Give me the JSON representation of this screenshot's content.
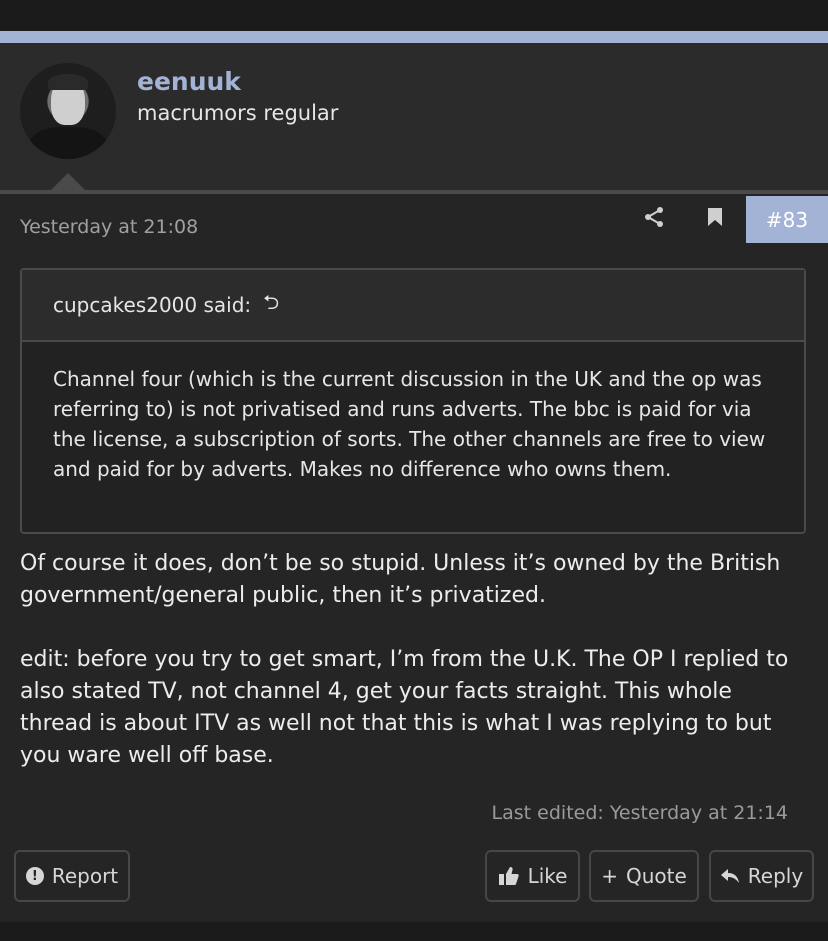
{
  "user": {
    "name": "eenuuk",
    "title": "macrumors regular"
  },
  "post": {
    "date": "Yesterday at 21:08",
    "number": "#83",
    "quote": {
      "author_label": "cupcakes2000 said:",
      "text": "Channel four (which is the current discussion in the UK and the op was referring to) is not privatised and runs adverts. The bbc is paid for via the license, a subscription of sorts. The other channels are free to view and paid for by adverts. Makes no difference who owns them."
    },
    "message": [
      "Of course it does, don’t be so stupid. Unless it’s owned by the British government/general public, then it’s privatized.",
      "edit: before you try to get smart, I’m from the U.K. The OP I replied to also stated TV, not channel 4, get your facts straight. This whole thread is about ITV as well not that this is what I was replying to but you ware well off base."
    ],
    "last_edited": "Last edited: Yesterday at 21:14"
  },
  "actions": {
    "report": "Report",
    "like": "Like",
    "quote": "Quote",
    "reply": "Reply"
  },
  "icons": {
    "share": "share-icon",
    "bookmark": "bookmark-icon",
    "expand": "expand-quote-icon",
    "report": "report-icon",
    "like": "thumbs-up-icon",
    "quote": "plus-icon",
    "reply": "reply-arrow-icon"
  },
  "colors": {
    "accent": "#a3b3d6",
    "background": "#252525",
    "header": "#2b2b2b"
  }
}
